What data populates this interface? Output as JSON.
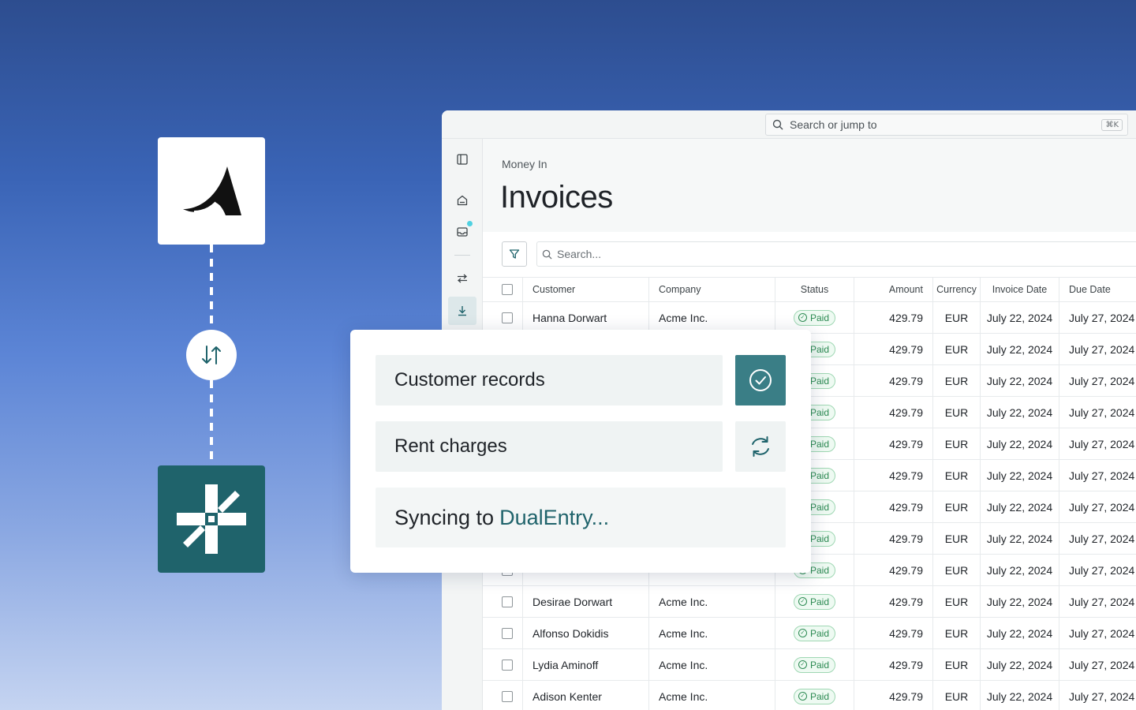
{
  "colors": {
    "accent_teal": "#1f636b",
    "check_bg": "#3a7e86",
    "paid_green": "#2c8a52"
  },
  "integration": {
    "source_logo": "wing-logo-icon",
    "target_logo": "dualentry-logo-icon",
    "swap_icon": "swap-arrows-icon"
  },
  "app": {
    "search": {
      "placeholder": "Search or jump to",
      "shortcut": "⌘K"
    },
    "sidebar": {
      "items": [
        {
          "icon": "panel-toggle-icon"
        },
        {
          "icon": "home-icon"
        },
        {
          "icon": "inbox-icon"
        },
        {
          "icon": "transfer-icon"
        },
        {
          "icon": "download-icon",
          "active": true
        }
      ]
    },
    "breadcrumb": "Money In",
    "title": "Invoices",
    "table_search_placeholder": "Search...",
    "columns": [
      "Customer",
      "Company",
      "Status",
      "Amount",
      "Currency",
      "Invoice Date",
      "Due Date"
    ],
    "rows": [
      {
        "customer": "Hanna Dorwart",
        "company": "Acme Inc.",
        "status": "Paid",
        "amount": "429.79",
        "currency": "EUR",
        "invoice_date": "July 22, 2024",
        "due_date": "July 27, 2024"
      },
      {
        "customer": "",
        "company": "",
        "status": "Paid",
        "amount": "429.79",
        "currency": "EUR",
        "invoice_date": "July 22, 2024",
        "due_date": "July 27, 2024"
      },
      {
        "customer": "",
        "company": "",
        "status": "Paid",
        "amount": "429.79",
        "currency": "EUR",
        "invoice_date": "July 22, 2024",
        "due_date": "July 27, 2024"
      },
      {
        "customer": "",
        "company": "",
        "status": "Paid",
        "amount": "429.79",
        "currency": "EUR",
        "invoice_date": "July 22, 2024",
        "due_date": "July 27, 2024"
      },
      {
        "customer": "",
        "company": "",
        "status": "Paid",
        "amount": "429.79",
        "currency": "EUR",
        "invoice_date": "July 22, 2024",
        "due_date": "July 27, 2024"
      },
      {
        "customer": "",
        "company": "",
        "status": "Paid",
        "amount": "429.79",
        "currency": "EUR",
        "invoice_date": "July 22, 2024",
        "due_date": "July 27, 2024"
      },
      {
        "customer": "",
        "company": "",
        "status": "Paid",
        "amount": "429.79",
        "currency": "EUR",
        "invoice_date": "July 22, 2024",
        "due_date": "July 27, 2024"
      },
      {
        "customer": "",
        "company": "",
        "status": "Paid",
        "amount": "429.79",
        "currency": "EUR",
        "invoice_date": "July 22, 2024",
        "due_date": "July 27, 2024"
      },
      {
        "customer": "",
        "company": "",
        "status": "Paid",
        "amount": "429.79",
        "currency": "EUR",
        "invoice_date": "July 22, 2024",
        "due_date": "July 27, 2024"
      },
      {
        "customer": "Desirae Dorwart",
        "company": "Acme Inc.",
        "status": "Paid",
        "amount": "429.79",
        "currency": "EUR",
        "invoice_date": "July 22, 2024",
        "due_date": "July 27, 2024"
      },
      {
        "customer": "Alfonso Dokidis",
        "company": "Acme Inc.",
        "status": "Paid",
        "amount": "429.79",
        "currency": "EUR",
        "invoice_date": "July 22, 2024",
        "due_date": "July 27, 2024"
      },
      {
        "customer": "Lydia Aminoff",
        "company": "Acme Inc.",
        "status": "Paid",
        "amount": "429.79",
        "currency": "EUR",
        "invoice_date": "July 22, 2024",
        "due_date": "July 27, 2024"
      },
      {
        "customer": "Adison Kenter",
        "company": "Acme Inc.",
        "status": "Paid",
        "amount": "429.79",
        "currency": "EUR",
        "invoice_date": "July 22, 2024",
        "due_date": "July 27, 2024"
      }
    ]
  },
  "sync_card": {
    "items": [
      {
        "label": "Customer records",
        "state": "done",
        "icon": "check-circle-icon"
      },
      {
        "label": "Rent charges",
        "state": "syncing",
        "icon": "sync-icon"
      }
    ],
    "status_prefix": "Syncing to",
    "status_brand": "DualEntry..."
  }
}
